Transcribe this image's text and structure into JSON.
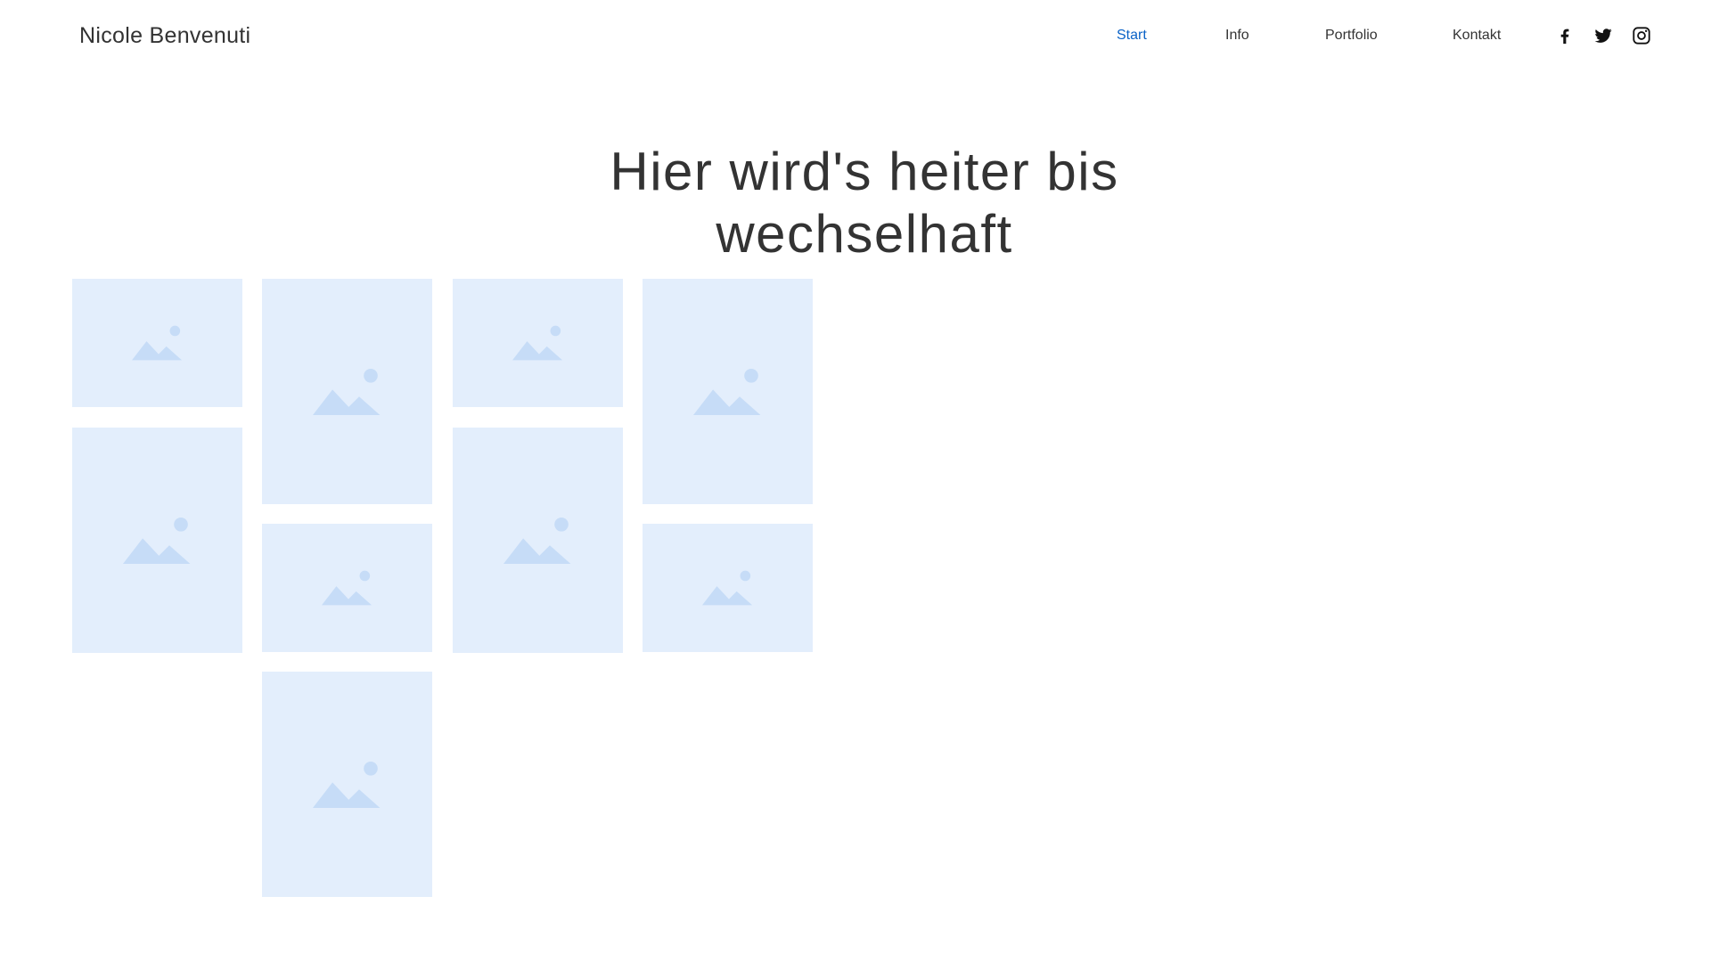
{
  "site": {
    "name": "Nicole Benvenuti"
  },
  "nav": {
    "items": [
      {
        "label": "Start",
        "active": true
      },
      {
        "label": "Info",
        "active": false
      },
      {
        "label": "Portfolio",
        "active": false
      },
      {
        "label": "Kontakt",
        "active": false
      }
    ],
    "social": [
      "facebook-icon",
      "twitter-icon",
      "instagram-icon"
    ]
  },
  "hero": {
    "title_line1": "Hier wird's heiter bis",
    "title_line2": "wechselhaft"
  },
  "gallery": {
    "placeholder_icon": "image-placeholder-icon",
    "tile_count": 9
  },
  "colors": {
    "accent": "#0b63c7",
    "text": "#333333",
    "placeholder_bg": "#e3eefc",
    "placeholder_icon": "#c6dcf7"
  }
}
